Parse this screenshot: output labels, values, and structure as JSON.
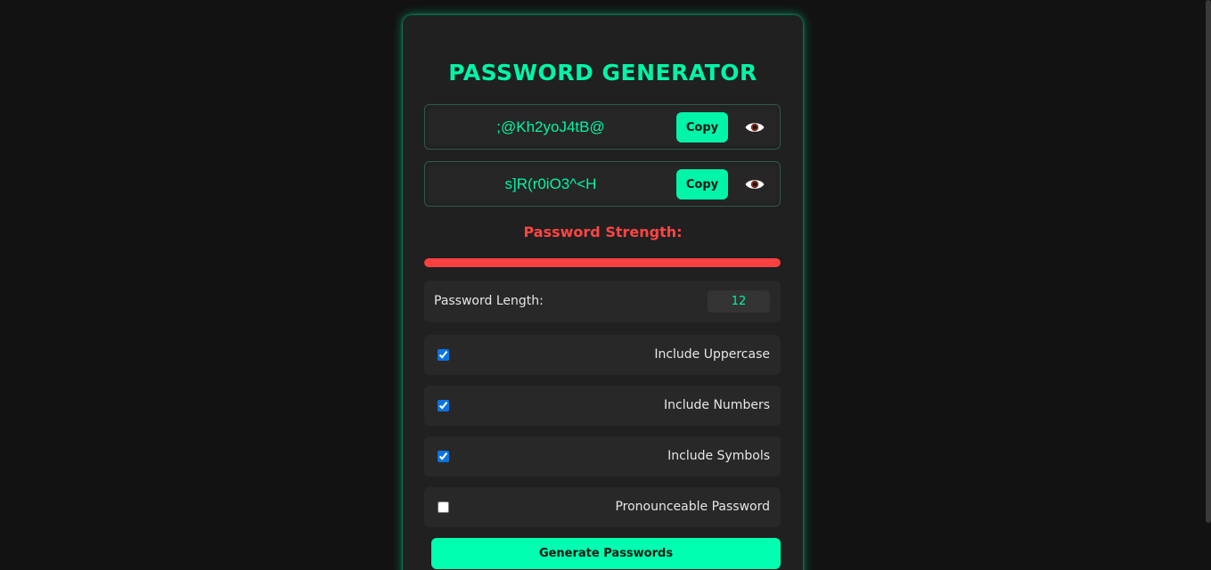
{
  "app": {
    "title": "PASSWORD GENERATOR"
  },
  "passwords": [
    {
      "value": ";@Kh2yoJ4tB@",
      "copy_label": "Copy",
      "toggle_icon": "eye-icon"
    },
    {
      "value": "s]R(r0iO3^<H",
      "copy_label": "Copy",
      "toggle_icon": "eye-icon"
    }
  ],
  "strength": {
    "label": "Password Strength:",
    "level_percent": 100,
    "color": "#ff4040"
  },
  "length": {
    "label": "Password Length:",
    "value": "12"
  },
  "options": [
    {
      "label": "Include Uppercase",
      "checked": true
    },
    {
      "label": "Include Numbers",
      "checked": true
    },
    {
      "label": "Include Symbols",
      "checked": true
    },
    {
      "label": "Pronounceable Password",
      "checked": false
    }
  ],
  "generate_label": "Generate Passwords",
  "colors": {
    "accent": "#00f5a8",
    "background": "#121212",
    "card": "#202020",
    "warning": "#ff4444"
  }
}
